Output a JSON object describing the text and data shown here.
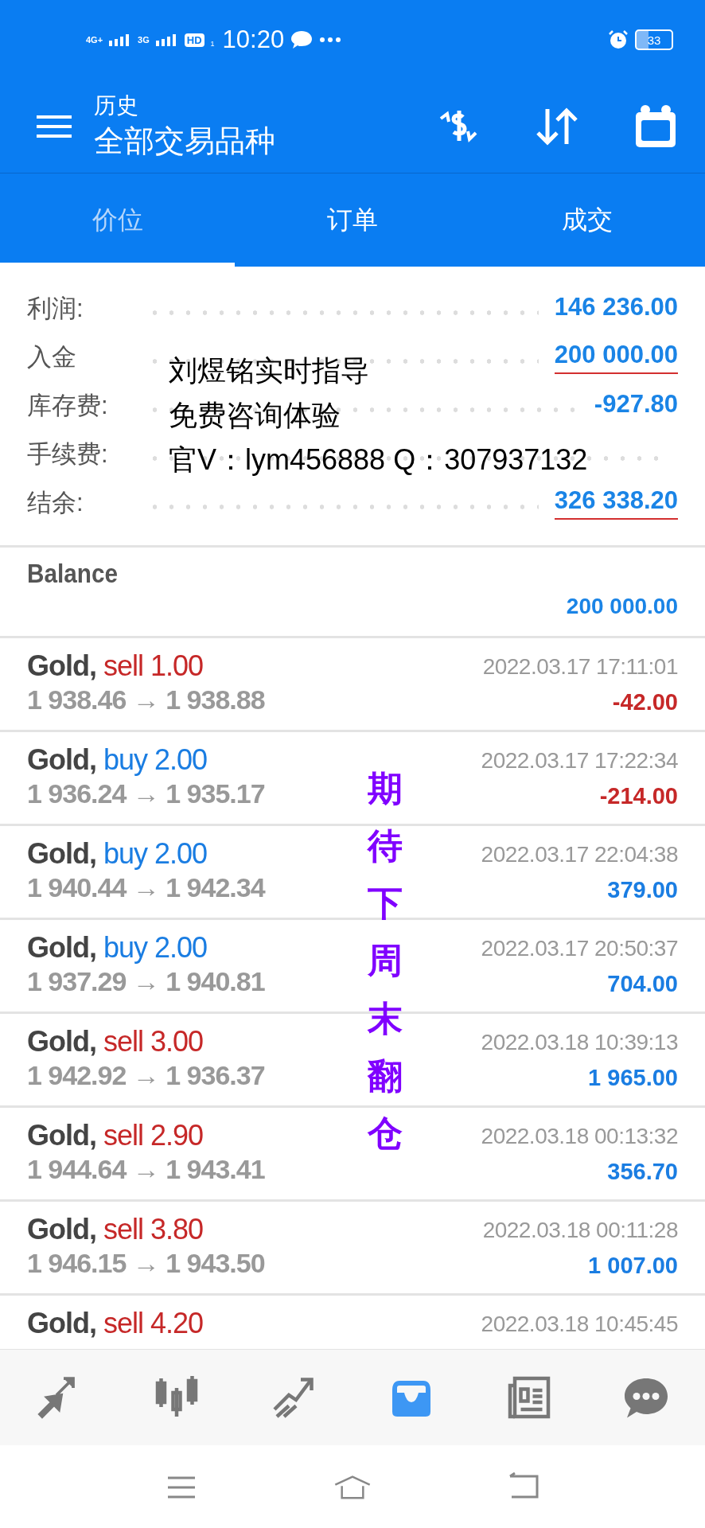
{
  "status_bar": {
    "network_1": "4G+",
    "network_2": "3G",
    "hd": "HD",
    "sim": "1",
    "time": "10:20",
    "battery": "33"
  },
  "toolbar": {
    "subtitle": "历史",
    "title": "全部交易品种"
  },
  "tabs": [
    {
      "label": "价位",
      "selected": true
    },
    {
      "label": "订单",
      "selected": false
    },
    {
      "label": "成交",
      "selected": false
    }
  ],
  "summary": [
    {
      "label": "利润:",
      "value": "146 236.00",
      "underlined": false
    },
    {
      "label": "入金",
      "value": "200 000.00",
      "underlined": true
    },
    {
      "label": "库存费:",
      "value": "-927.80",
      "underlined": false
    },
    {
      "label": "手续费:"
    },
    {
      "label": "结余:",
      "value": "326 338.20",
      "underlined": true
    }
  ],
  "balance": {
    "label": "Balance",
    "value": "200 000.00"
  },
  "trades": [
    {
      "symbol": "Gold,",
      "side": "sell",
      "volume": "1.00",
      "prices": "1 938.46 → 1 938.88",
      "time": "2022.03.17 17:11:01",
      "profit": "-42.00",
      "loss": true
    },
    {
      "symbol": "Gold,",
      "side": "buy",
      "volume": "2.00",
      "prices": "1 936.24 → 1 935.17",
      "time": "2022.03.17 17:22:34",
      "profit": "-214.00",
      "loss": true
    },
    {
      "symbol": "Gold,",
      "side": "buy",
      "volume": "2.00",
      "prices": "1 940.44 → 1 942.34",
      "time": "2022.03.17 22:04:38",
      "profit": "379.00",
      "loss": false
    },
    {
      "symbol": "Gold,",
      "side": "buy",
      "volume": "2.00",
      "prices": "1 937.29 → 1 940.81",
      "time": "2022.03.17 20:50:37",
      "profit": "704.00",
      "loss": false
    },
    {
      "symbol": "Gold,",
      "side": "sell",
      "volume": "3.00",
      "prices": "1 942.92 → 1 936.37",
      "time": "2022.03.18 10:39:13",
      "profit": "1 965.00",
      "loss": false
    },
    {
      "symbol": "Gold,",
      "side": "sell",
      "volume": "2.90",
      "prices": "1 944.64 → 1 943.41",
      "time": "2022.03.18 00:13:32",
      "profit": "356.70",
      "loss": false
    },
    {
      "symbol": "Gold,",
      "side": "sell",
      "volume": "3.80",
      "prices": "1 946.15 → 1 943.50",
      "time": "2022.03.18 00:11:28",
      "profit": "1 007.00",
      "loss": false
    },
    {
      "symbol": "Gold,",
      "side": "sell",
      "volume": "4.20",
      "time": "2022.03.18 10:45:45"
    }
  ],
  "bottom_nav": [
    {
      "kind": "quotes",
      "selected": false
    },
    {
      "kind": "chart",
      "selected": false
    },
    {
      "kind": "trade",
      "selected": false
    },
    {
      "kind": "history",
      "selected": true
    },
    {
      "kind": "news",
      "selected": false
    },
    {
      "kind": "chat",
      "selected": false
    }
  ],
  "overlay": {
    "lines": [
      "刘煜铭实时指导",
      "免费咨询体验",
      "官V：lym456888 Q：307937132"
    ],
    "vertical": "期待下周末翻仓"
  }
}
